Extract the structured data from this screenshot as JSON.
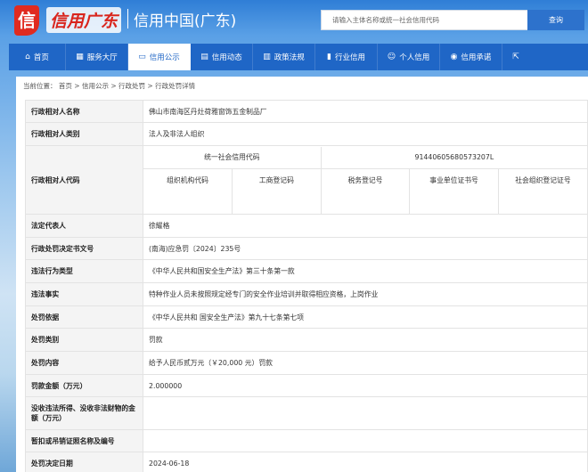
{
  "header": {
    "logo_mark": "信",
    "logo_script": "信用广东",
    "site_title": "信用中国(广东)",
    "search_placeholder": "请输入主体名称或统一社会信用代码",
    "search_button": "查询"
  },
  "nav": [
    {
      "label": "首页",
      "icon": "home-icon",
      "glyph": "⌂"
    },
    {
      "label": "服务大厅",
      "icon": "grid-icon",
      "glyph": "▦"
    },
    {
      "label": "信用公示",
      "icon": "monitor-icon",
      "glyph": "▭"
    },
    {
      "label": "信用动态",
      "icon": "document-icon",
      "glyph": "▤"
    },
    {
      "label": "政策法规",
      "icon": "book-icon",
      "glyph": "▥"
    },
    {
      "label": "行业信用",
      "icon": "building-icon",
      "glyph": "▮"
    },
    {
      "label": "个人信用",
      "icon": "user-icon",
      "glyph": "☺"
    },
    {
      "label": "信用承诺",
      "icon": "shield-icon",
      "glyph": "◉"
    },
    {
      "label": "",
      "icon": "external-icon",
      "glyph": "⇱"
    }
  ],
  "breadcrumb": {
    "prefix": "当前位置：",
    "items": [
      "首页",
      "信用公示",
      "行政处罚",
      "行政处罚详情"
    ],
    "separator": " > "
  },
  "record": {
    "rows": [
      {
        "label": "行政相对人名称",
        "value": "佛山市南海区丹灶荷雅窗饰五金制品厂"
      },
      {
        "label": "行政相对人类别",
        "value": "法人及非法人组织"
      },
      {
        "label": "行政相对人代码",
        "value": ""
      },
      {
        "label": "法定代表人",
        "value": "徐耀格"
      },
      {
        "label": "行政处罚决定书文号",
        "value": "(南海)应急罚〔2024〕235号"
      },
      {
        "label": "违法行为类型",
        "value": "《中华人民共和国安全生产法》第三十条第一款"
      },
      {
        "label": "违法事实",
        "value": "特种作业人员未按照规定经专门的安全作业培训并取得相应资格，上岗作业"
      },
      {
        "label": "处罚依据",
        "value": "《中华人民共和 国安全生产法》第九十七条第七项"
      },
      {
        "label": "处罚类别",
        "value": "罚款"
      },
      {
        "label": "处罚内容",
        "value": "给予人民币贰万元（￥20,000 元）罚款"
      },
      {
        "label": "罚款金额（万元）",
        "value": "2.000000"
      },
      {
        "label": "没收违法所得、没收非法财物的金额（万元）",
        "value": ""
      },
      {
        "label": "暂扣或吊销证照名称及编号",
        "value": ""
      },
      {
        "label": "处罚决定日期",
        "value": "2024-06-18"
      }
    ],
    "codes": {
      "uscc_label": "统一社会信用代码",
      "uscc_value": "91440605680573207L",
      "sub_headers": [
        "组织机构代码",
        "工商登记码",
        "税务登记号",
        "事业单位证书号",
        "社会组织登记证号"
      ],
      "sub_values": [
        "",
        "",
        "",
        "",
        ""
      ]
    }
  }
}
